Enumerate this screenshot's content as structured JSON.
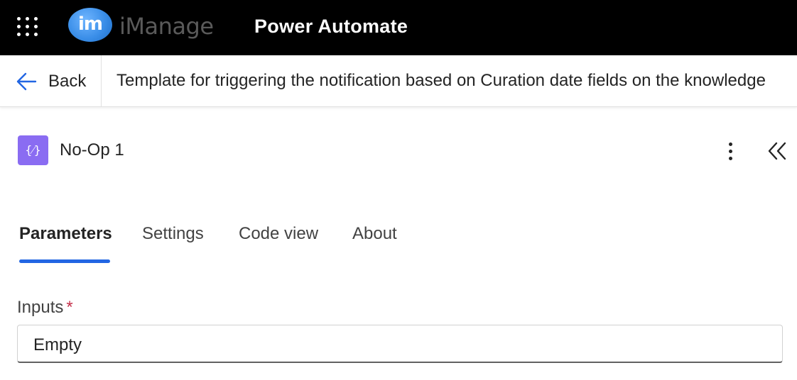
{
  "header": {
    "app_launcher_icon": "waffle-icon",
    "logo_text": "iManage",
    "logo_mark": "im",
    "app_title": "Power Automate"
  },
  "nav": {
    "back_icon": "arrow-left-icon",
    "back_label": "Back",
    "flow_title": "Template for triggering the notification based on Curation date fields on the knowledge"
  },
  "action": {
    "icon": "variable-braces-icon",
    "icon_glyph": "{⁄}",
    "icon_color": "#8a6cf2",
    "name": "No-Op 1",
    "more_icon": "more-vertical-icon",
    "collapse_icon": "chevron-double-left-icon"
  },
  "tabs": [
    {
      "label": "Parameters",
      "active": true
    },
    {
      "label": "Settings",
      "active": false
    },
    {
      "label": "Code view",
      "active": false
    },
    {
      "label": "About",
      "active": false
    }
  ],
  "parameters": {
    "inputs_label": "Inputs",
    "required_marker": "*",
    "inputs_value": "Empty"
  },
  "colors": {
    "accent": "#2266e3",
    "topbar": "#000000",
    "required": "#c4314b"
  }
}
